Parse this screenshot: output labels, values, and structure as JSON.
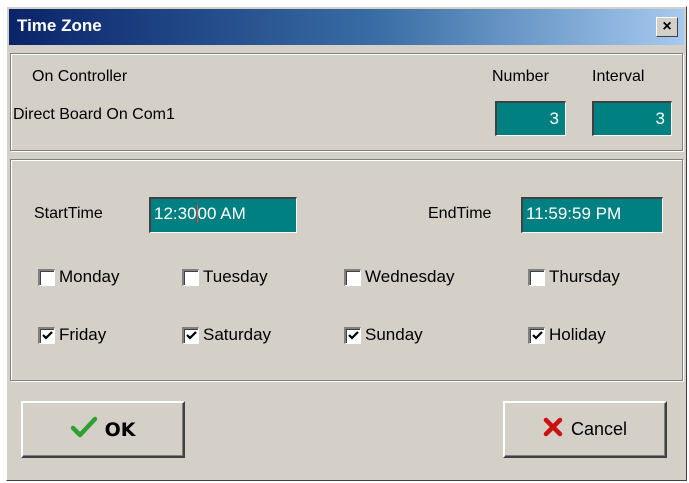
{
  "window": {
    "title": "Time Zone",
    "close_glyph": "×"
  },
  "controller": {
    "heading": "On Controller",
    "value": "Direct Board On Com1",
    "number_label": "Number",
    "number_value": "3",
    "interval_label": "Interval",
    "interval_value": "3"
  },
  "times": {
    "start_label": "StartTime",
    "start_value_a": "12:30",
    "start_value_b": "00 AM",
    "end_label": "EndTime",
    "end_value": "11:59:59 PM"
  },
  "days": [
    {
      "label": "Monday",
      "checked": false
    },
    {
      "label": "Tuesday",
      "checked": false
    },
    {
      "label": "Wednesday",
      "checked": false
    },
    {
      "label": "Thursday",
      "checked": false
    },
    {
      "label": "Friday",
      "checked": true
    },
    {
      "label": "Saturday",
      "checked": true
    },
    {
      "label": "Sunday",
      "checked": true
    },
    {
      "label": "Holiday",
      "checked": true
    }
  ],
  "buttons": {
    "ok_label": "OK",
    "ok_icon": "checkmark-icon",
    "cancel_label": "Cancel",
    "cancel_icon": "x-icon"
  },
  "colors": {
    "field_bg": "#008080",
    "ok_icon": "#2fa02f",
    "cancel_icon": "#cc1010"
  }
}
